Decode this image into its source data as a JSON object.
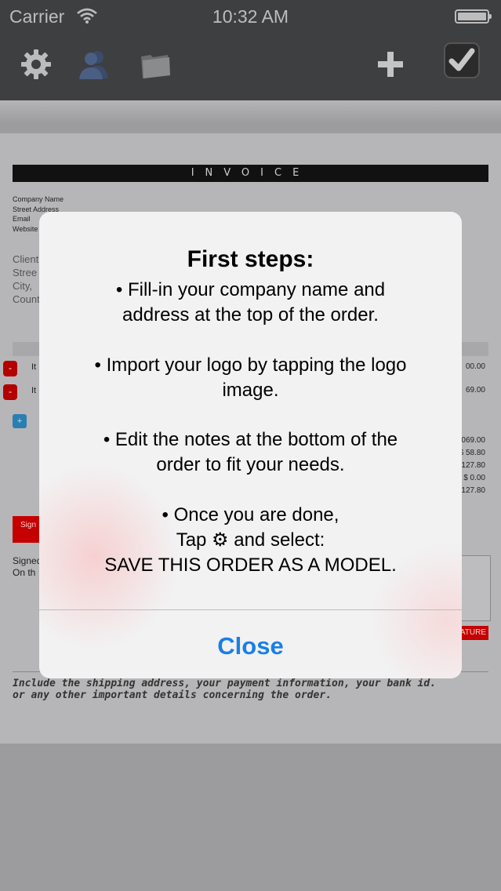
{
  "status": {
    "carrier": "Carrier",
    "time": "10:32 AM"
  },
  "toolbar": {
    "icons": [
      "gear-icon",
      "contacts-icon",
      "folder-icon",
      "plus-icon",
      "checkmark-icon"
    ]
  },
  "document": {
    "invoice_title": "INVOICE",
    "company_lines": [
      "Company Name",
      "Street Address",
      "Email",
      "Website"
    ],
    "client_lines": [
      "Client",
      "Stree",
      "City,",
      "Count"
    ],
    "items": [
      {
        "label": "It",
        "amount": "00.00"
      },
      {
        "label": "It",
        "amount": "69.00"
      }
    ],
    "totals": [
      ".069.00",
      "$ 58.80",
      ".127.80",
      "$ 0.00",
      ".127.80"
    ],
    "sign_button": "Sign",
    "signed_lines": [
      "Signed",
      "On th"
    ],
    "signature_button": "NATURE",
    "notes_lines": [
      "Include the shipping address, your payment information, your bank id.",
      "or any other important details concerning the order."
    ]
  },
  "alert": {
    "title": "First steps:",
    "steps": [
      [
        "• Fill-in your company name and",
        "address at the top of the order."
      ],
      [
        "• Import your logo by tapping the logo",
        "image."
      ],
      [
        "• Edit the notes at the bottom of the",
        "order to fit your needs."
      ],
      [
        "• Once you are done,",
        "Tap ⚙ and select:",
        "SAVE THIS ORDER AS A MODEL."
      ]
    ],
    "close_label": "Close"
  },
  "colors": {
    "toolbar_bg": "#3e3f41",
    "accent_blue": "#1a7fe6",
    "invoice_red": "#c40000"
  }
}
